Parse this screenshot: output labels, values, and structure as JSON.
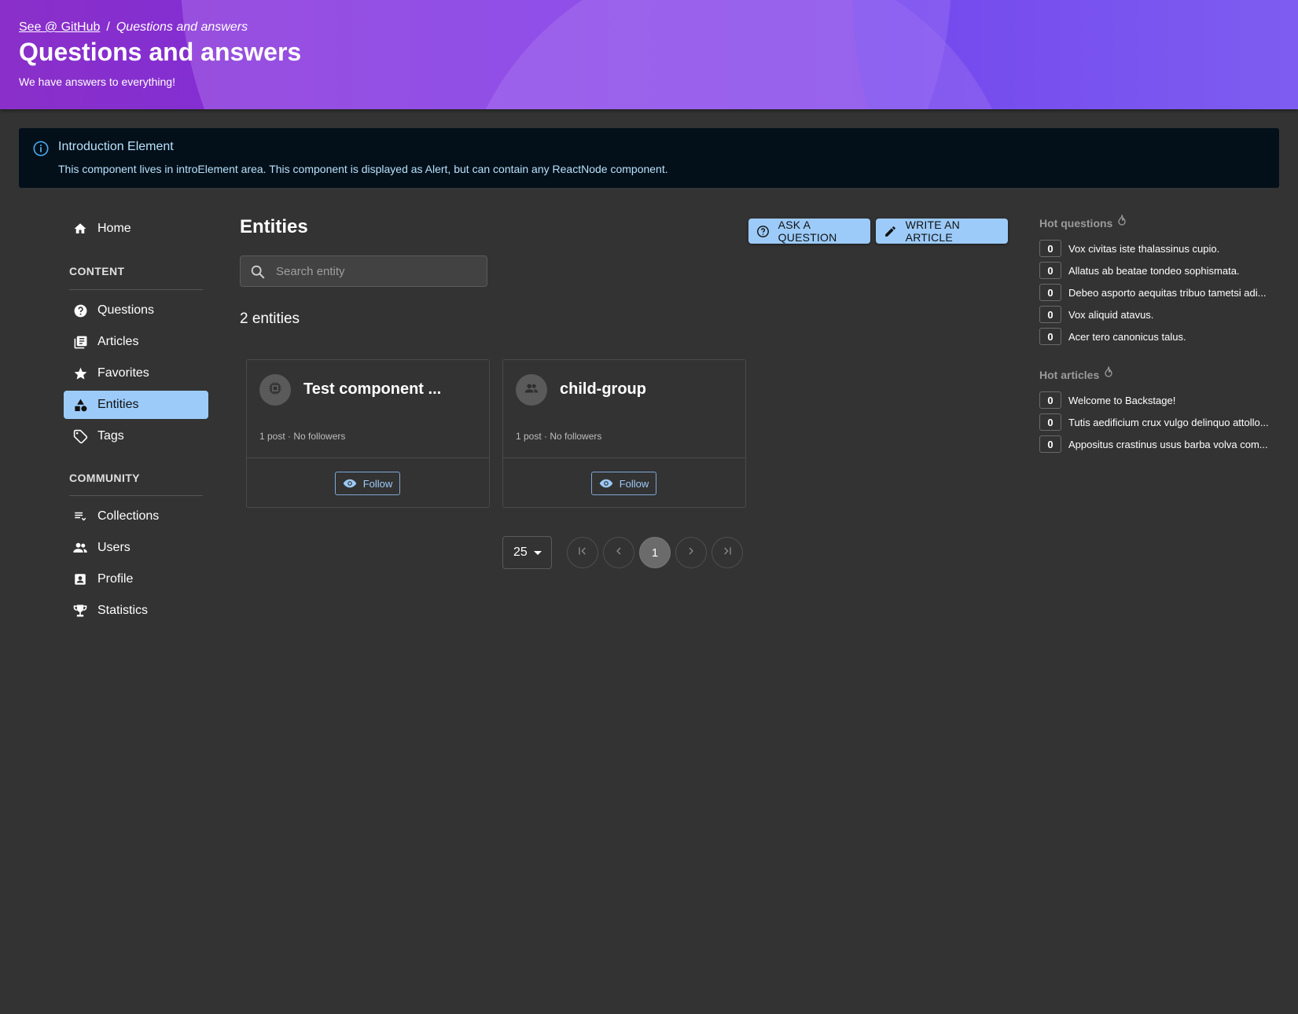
{
  "header": {
    "breadcrumb_link": "See @ GitHub",
    "breadcrumb_separator": "/",
    "breadcrumb_current": "Questions and answers",
    "title": "Questions and answers",
    "subtitle": "We have answers to everything!"
  },
  "alert": {
    "title": "Introduction Element",
    "text": "This component lives in introElement area. This component is displayed as Alert, but can contain any ReactNode component."
  },
  "sidebar": {
    "home": "Home",
    "content_heading": "CONTENT",
    "content_items": [
      {
        "label": "Questions",
        "icon": "help-circle-icon"
      },
      {
        "label": "Articles",
        "icon": "library-books-icon"
      },
      {
        "label": "Favorites",
        "icon": "star-icon"
      },
      {
        "label": "Entities",
        "icon": "category-icon"
      },
      {
        "label": "Tags",
        "icon": "tag-icon"
      }
    ],
    "community_heading": "COMMUNITY",
    "community_items": [
      {
        "label": "Collections",
        "icon": "playlist-icon"
      },
      {
        "label": "Users",
        "icon": "people-icon"
      },
      {
        "label": "Profile",
        "icon": "account-box-icon"
      },
      {
        "label": "Statistics",
        "icon": "trophy-icon"
      }
    ],
    "active": "Entities"
  },
  "main": {
    "title": "Entities",
    "ask_button": "ASK A QUESTION",
    "write_button": "WRITE AN ARTICLE",
    "search_placeholder": "Search entity",
    "count": "2 entities",
    "cards": [
      {
        "name": "Test component ...",
        "meta": "1 post · No followers",
        "follow": "Follow",
        "icon": "chip-icon"
      },
      {
        "name": "child-group",
        "meta": "1 post · No followers",
        "follow": "Follow",
        "icon": "group-icon"
      }
    ],
    "per_page": "25",
    "current_page": "1"
  },
  "hot": {
    "questions_title": "Hot questions",
    "questions": [
      {
        "score": "0",
        "title": "Vox civitas iste thalassinus cupio."
      },
      {
        "score": "0",
        "title": "Allatus ab beatae tondeo sophismata."
      },
      {
        "score": "0",
        "title": "Debeo asporto aequitas tribuo tametsi adi..."
      },
      {
        "score": "0",
        "title": "Vox aliquid atavus."
      },
      {
        "score": "0",
        "title": "Acer tero canonicus talus."
      }
    ],
    "articles_title": "Hot articles",
    "articles": [
      {
        "score": "0",
        "title": "Welcome to Backstage!"
      },
      {
        "score": "0",
        "title": "Tutis aedificium crux vulgo delinquo attollo..."
      },
      {
        "score": "0",
        "title": "Appositus crastinus usus barba volva com..."
      }
    ]
  },
  "colors": {
    "accent": "#9ccbfa",
    "background": "#333333",
    "alert_background": "#03101a",
    "header_gradient_start": "#8a2fc9",
    "header_gradient_end": "#7a57ee"
  }
}
